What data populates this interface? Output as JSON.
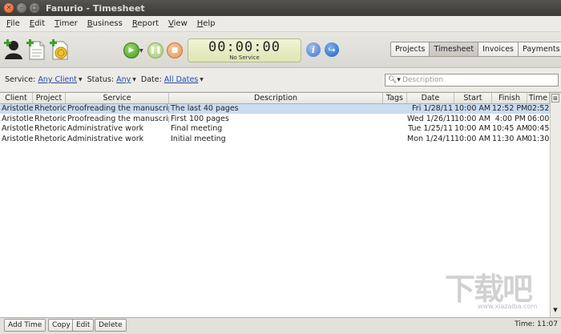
{
  "window": {
    "title": "Fanurio - Timesheet"
  },
  "menu": [
    {
      "first": "F",
      "rest": "ile"
    },
    {
      "first": "E",
      "rest": "dit"
    },
    {
      "first": "T",
      "rest": "imer"
    },
    {
      "first": "B",
      "rest": "usiness"
    },
    {
      "first": "R",
      "rest": "eport"
    },
    {
      "first": "V",
      "rest": "iew"
    },
    {
      "first": "H",
      "rest": "elp"
    }
  ],
  "timer": {
    "time": "00:00:00",
    "service": "No Service"
  },
  "tabs": [
    "Projects",
    "Timesheet",
    "Invoices",
    "Payments"
  ],
  "active_tab": "Timesheet",
  "filters": {
    "service_label": "Service:",
    "service_value": "Any Client",
    "status_label": "Status:",
    "status_value": "Any",
    "date_label": "Date:",
    "date_value": "All Dates",
    "search_placeholder": "Description"
  },
  "table": {
    "columns": [
      "Client",
      "Project",
      "Service",
      "Description",
      "Tags",
      "Date",
      "Start",
      "Finish",
      "Time"
    ],
    "rows": [
      [
        "Aristotle",
        "Rhetoric",
        "Proofreading the manuscript",
        "The last 40 pages",
        "",
        "Fri 1/28/11",
        "10:00 AM",
        "12:52 PM",
        "02:52"
      ],
      [
        "Aristotle",
        "Rhetoric",
        "Proofreading the manuscript",
        "First 100 pages",
        "",
        "Wed 1/26/11",
        "10:00 AM",
        "4:00 PM",
        "06:00"
      ],
      [
        "Aristotle",
        "Rhetoric",
        "Administrative work",
        "Final meeting",
        "",
        "Tue 1/25/11",
        "10:00 AM",
        "10:45 AM",
        "00:45"
      ],
      [
        "Aristotle",
        "Rhetoric",
        "Administrative work",
        "Initial meeting",
        "",
        "Mon 1/24/11",
        "10:00 AM",
        "11:30 AM",
        "01:30"
      ]
    ],
    "selected_row": 0
  },
  "bottom": {
    "buttons": [
      "Add Time",
      "Copy",
      "Edit",
      "Delete"
    ],
    "status": "Time: 11:07"
  },
  "watermark": {
    "text": "下载吧",
    "sub": "www.xiazaiba.com"
  }
}
